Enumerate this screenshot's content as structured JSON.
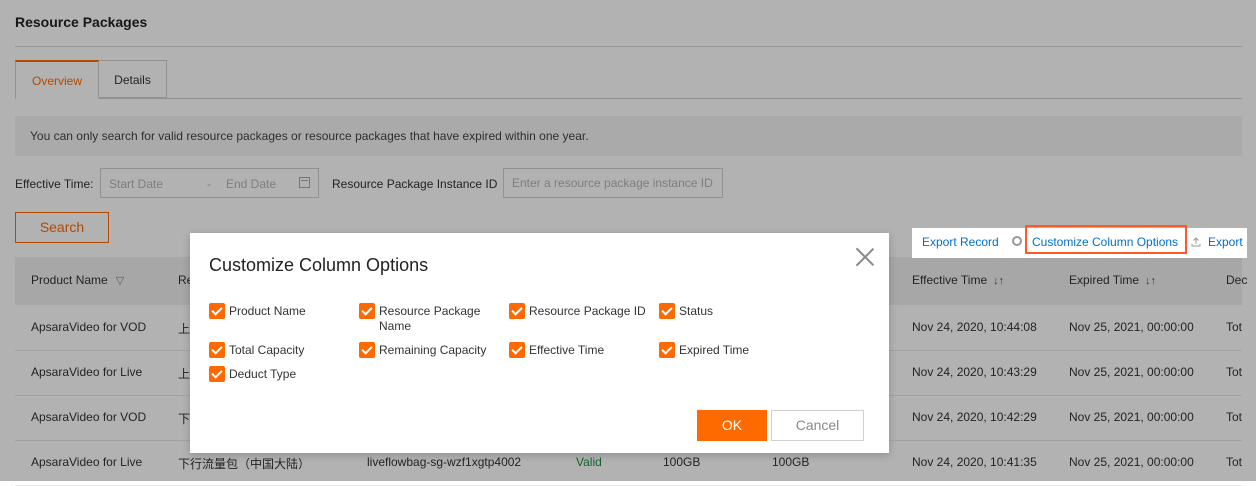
{
  "page": {
    "title": "Resource Packages"
  },
  "tabs": [
    {
      "label": "Overview"
    },
    {
      "label": "Details"
    }
  ],
  "notice": "You can only search for valid resource packages or resource packages that have expired within one year.",
  "filters": {
    "effective_time_label": "Effective Time:",
    "start_placeholder": "Start Date",
    "separator": "-",
    "end_placeholder": "End Date",
    "instance_id_label": "Resource Package Instance ID",
    "instance_id_placeholder": "Enter a resource package instance ID."
  },
  "search_label": "Search",
  "toolbar": {
    "export_record": "Export Record",
    "customize_columns": "Customize Column Options",
    "export": "Export"
  },
  "table": {
    "headers": [
      "Product Name",
      "Re",
      "Effective Time",
      "Expired Time",
      "Dec"
    ],
    "rows": [
      {
        "product": "ApsaraVideo for VOD",
        "name": "上",
        "package_id": "",
        "status": "",
        "total": "",
        "remaining": "",
        "effective": "Nov 24, 2020, 10:44:08",
        "expired": "Nov 25, 2021, 00:00:00",
        "deduct": "Tot"
      },
      {
        "product": "ApsaraVideo for Live",
        "name": "上",
        "package_id": "",
        "status": "",
        "total": "",
        "remaining": "",
        "effective": "Nov 24, 2020, 10:43:29",
        "expired": "Nov 25, 2021, 00:00:00",
        "deduct": "Tot"
      },
      {
        "product": "ApsaraVideo for VOD",
        "name": "下",
        "package_id": "",
        "status": "",
        "total": "",
        "remaining": "",
        "effective": "Nov 24, 2020, 10:42:29",
        "expired": "Nov 25, 2021, 00:00:00",
        "deduct": "Tot"
      },
      {
        "product": "ApsaraVideo for Live",
        "name": "下行流量包（中国大陆）",
        "package_id": "liveflowbag-sg-wzf1xgtp4002",
        "status": "Valid",
        "total": "100GB",
        "remaining": "100GB",
        "effective": "Nov 24, 2020, 10:41:35",
        "expired": "Nov 25, 2021, 00:00:00",
        "deduct": "Tot"
      }
    ]
  },
  "dialog": {
    "title": "Customize Column Options",
    "options": [
      {
        "label": "Product Name",
        "checked": true
      },
      {
        "label": "Resource Package Name",
        "checked": true
      },
      {
        "label": "Resource Package ID",
        "checked": true
      },
      {
        "label": "Status",
        "checked": true
      },
      {
        "label": "Total Capacity",
        "checked": true
      },
      {
        "label": "Remaining Capacity",
        "checked": true
      },
      {
        "label": "Effective Time",
        "checked": true
      },
      {
        "label": "Expired Time",
        "checked": true
      },
      {
        "label": "Deduct Type",
        "checked": true
      }
    ],
    "ok_label": "OK",
    "cancel_label": "Cancel"
  },
  "colors": {
    "accent": "#ff6a00",
    "link": "#0070cc",
    "valid": "#1e8e3e",
    "highlight": "#ff5a24"
  }
}
